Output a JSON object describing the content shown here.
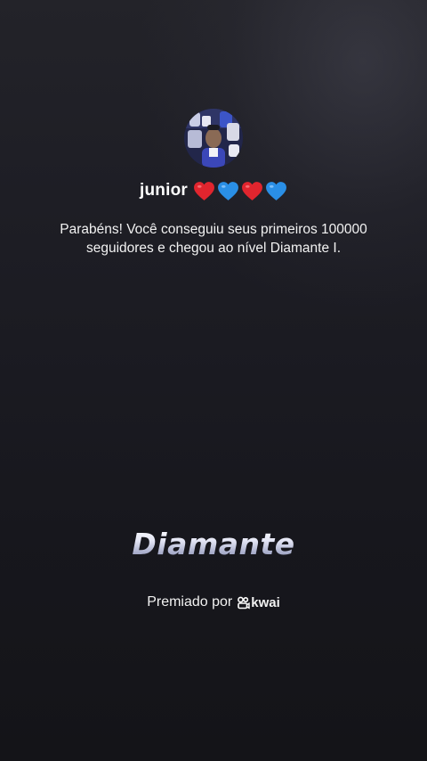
{
  "profile": {
    "username": "junior",
    "hearts": [
      {
        "icon": "red-heart-icon",
        "color": "#e0252e"
      },
      {
        "icon": "blue-heart-icon",
        "color": "#2a8fe6"
      },
      {
        "icon": "red-heart-icon",
        "color": "#e0252e"
      },
      {
        "icon": "blue-heart-icon",
        "color": "#2a8fe6"
      }
    ]
  },
  "message": "Parabéns! Você conseguiu seus primeiros 100000 seguidores e chegou ao nível Diamante I.",
  "badge": {
    "title": "Diamante"
  },
  "footer": {
    "awarded_by": "Premiado por",
    "brand": "kwai"
  }
}
